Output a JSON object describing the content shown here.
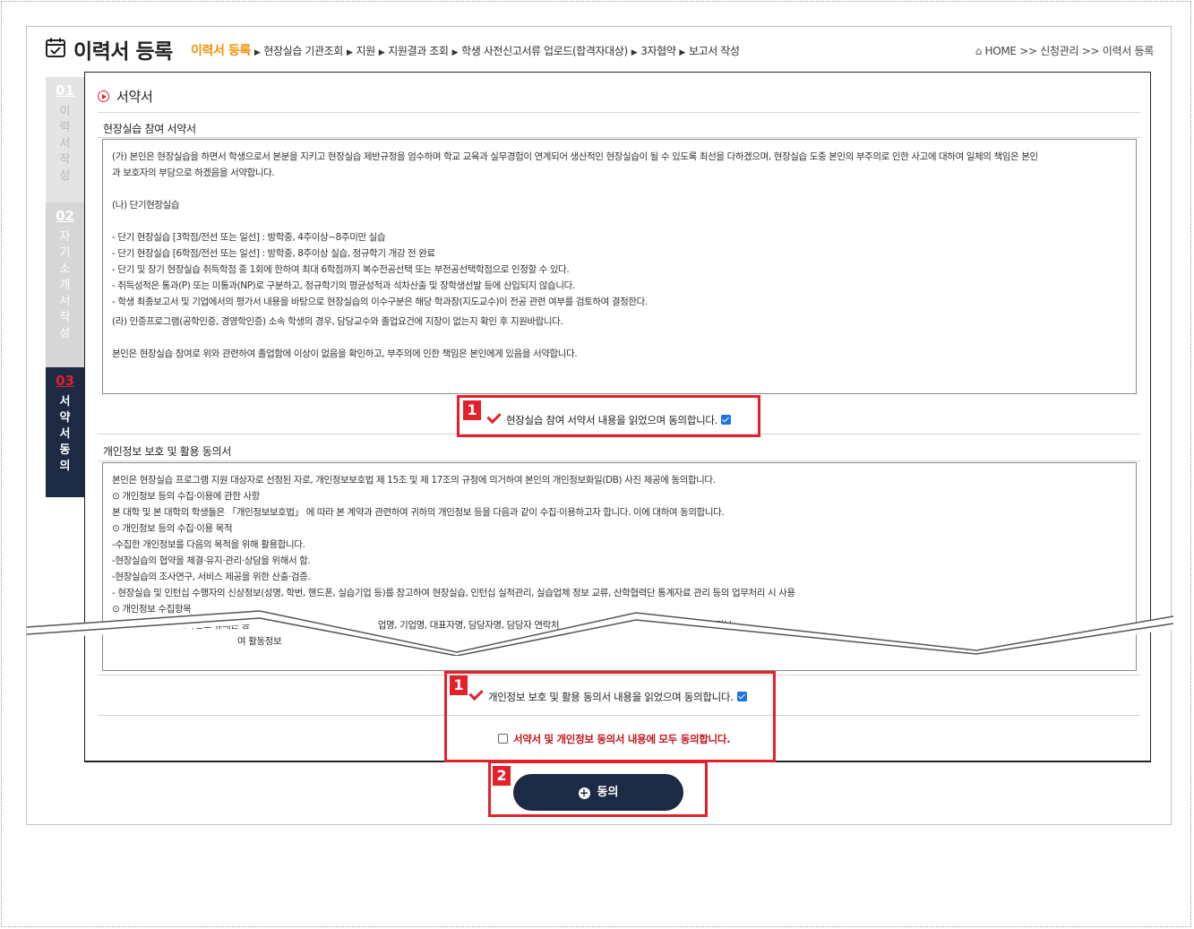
{
  "header": {
    "title": "이력서 등록",
    "steps": [
      "이력서 등록",
      "현장실습 기관조회",
      "지원",
      "지원결과 조회",
      "학생 사전신고서류 업로드(합격자대상)",
      "3자협약",
      "보고서 작성"
    ],
    "breadcrumb": {
      "home": "HOME",
      "level1": "신청관리",
      "level2": "이력서 등록",
      "separator": ">>"
    }
  },
  "sidebar": {
    "items": [
      {
        "num": "01",
        "label": "이력서작성",
        "chars": [
          "이",
          "력",
          "서",
          "작",
          "성"
        ]
      },
      {
        "num": "02",
        "label": "자기소개서작성",
        "chars": [
          "자",
          "기",
          "소",
          "개",
          "서",
          "작",
          "성"
        ]
      },
      {
        "num": "03",
        "label": "서약서동의",
        "chars": [
          "서",
          "약",
          "서",
          "동",
          "의"
        ]
      }
    ]
  },
  "main": {
    "section_title": "서약서",
    "pledge": {
      "title": "현장실습 참여 서약서",
      "lines": [
        "(가) 본인은 현장실습을 하면서 학생으로서 본분을 지키고 현장실습 제반규정을 엄수하며 학교 교육과 실무경험이  연계되어 생산적인 현장실습이 될 수 있도록 최선을 다하겠으며, 현장실습 도중 본인의 부주의로 인한 사고에 대하여 일체의 책임은 본인",
        "과 보호자의 부담으로 하겠음을 서약합니다.",
        "",
        "(나) 단기현장실습",
        "",
        "- 단기 현장실습 [3학점/전선 또는 일선] : 방학중, 4주이상~8주미만 실습",
        "- 단기 현장실습 [6학점/전선 또는 일선] : 방학중, 8주이상 실습, 정규학기 개강 전 완료",
        "- 단기 및 장기 현장실습 취득학점 중 1회에 한하여 최대 6학점까지 복수전공선택 또는 부전공선택학점으로 인정할 수 있다.",
        "- 취득성적은 통과(P) 또는 미통과(NP)로 구분하고, 정규학기의 평균성적과 석차산출 및 장학생선발 등에 산입되지 않습니다.",
        "- 학생 최종보고서 및 기업에서의 평가서 내용을 바탕으로 현장실습의 이수구분은 해당 학과장(지도교수)이 전공 관련 여부를 검토하여 결정한다.",
        " (라) 인증프로그램(공학인증, 경영학인증) 소속 학생의 경우, 담당교수와 졸업요건에 지장이 없는지 확인 후 지원바랍니다.",
        "",
        "본인은 현장실습 참여로 위와 관련하여 졸업함에 이상이 없음을 확인하고, 부주의에 인한 책임은 본인에게 있음을 서약합니다."
      ],
      "agree_label": "현장실습 참여 서약서 내용을 읽었으며 동의합니다.",
      "agree_checked": true
    },
    "privacy": {
      "title": "개인정보 보호 및 활용 동의서",
      "lines": [
        "본인은 현장실습 프로그램 지원 대상자로 선정된 자로, 개인정보보호법 제 15조 및 제 17조의 규정에 의거하여 본인의 개인정보화일(DB) 사진 제공에 동의합니다.",
        "⊙ 개인정보 등의 수집·이용에 관한 사항",
        "본 대학 및 본 대학의 학생들은 「개인정보보호법」 에 따라 본 계약과 관련하여 귀하의 개인정보 등을 다음과 같이 수집·이용하고자 합니다. 이에 대하여 동의합니다.",
        "⊙ 개인정보 등의 수집·이용 목적",
        "-수집한 개인정보를 다음의 목적을 위해 활용합니다.",
        "-현장실습의 협약을 체결·유지·관리·상담을 위해서 함.",
        "-현장실습의 조사연구, 서비스 제공을 위한 산출·검증.",
        "- 현장실습 및 인턴십 수행자의 신상정보(성명, 학번, 핸드폰, 실습기업 등)를 참고하여 현장실습, 인턴십 실적관리, 실습업체 정보 교류, 산학협력단 통계자료 관리 등의 업무처리 시 사용",
        "⊙ 개인정보 수집항목"
      ],
      "partial_line_a": "- 필수정보 : 이름,전화번호 휴대폰 등",
      "partial_line_b": "업명, 기업명, 대표자명, 담당자명, 담당자 연락처",
      "partial_line_c": "보서 정보",
      "partial_line_d": "여 활동정보",
      "agree_label": "개인정보 보호 및 활용 동의서 내용을 읽었으며 동의합니다.",
      "agree_checked": true
    },
    "all_agree_label": "서약서 및 개인정보 동의서 내용에 모두 동의합니다.",
    "all_agree_checked": false,
    "agree_button": "동의"
  },
  "annotations": {
    "badge1": "1",
    "badge2": "2"
  },
  "colors": {
    "accent_orange": "#f39200",
    "navy": "#1c2a44",
    "highlight_red": "#e4202b",
    "checkbox_blue": "#1a73e8"
  }
}
